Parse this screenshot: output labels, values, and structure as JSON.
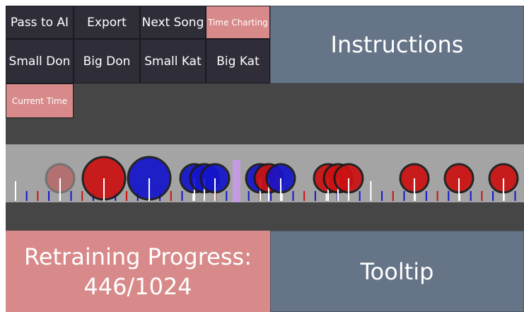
{
  "toolbar": {
    "row1": [
      {
        "label": "Pass to AI",
        "name": "pass-to-ai-button"
      },
      {
        "label": "Export",
        "name": "export-button"
      },
      {
        "label": "Next Song",
        "name": "next-song-button"
      },
      {
        "label": "Time Charting",
        "name": "time-charting-button"
      }
    ],
    "row2": [
      {
        "label": "Small Don",
        "name": "small-don-button"
      },
      {
        "label": "Big Don",
        "name": "big-don-button"
      },
      {
        "label": "Small Kat",
        "name": "small-kat-button"
      },
      {
        "label": "Big Kat",
        "name": "big-kat-button"
      }
    ],
    "current_time": "Current Time"
  },
  "instructions": {
    "label": "Instructions"
  },
  "progress": {
    "line1": "Retraining Progress:",
    "line2": "446/1024"
  },
  "tooltip": {
    "label": "Tooltip"
  },
  "colors": {
    "don": "#cc1111",
    "kat": "#1414cc",
    "accent_pink": "#d88a8a",
    "panel_slate": "#667487",
    "button_dark": "#2f2d38",
    "cursor": "#c49be0"
  },
  "notes": [
    {
      "kind": "don",
      "size": "small",
      "faded": true
    },
    {
      "kind": "don",
      "size": "big",
      "faded": false
    },
    {
      "kind": "kat",
      "size": "big",
      "faded": false
    },
    {
      "kind": "kat",
      "size": "small",
      "faded": false
    },
    {
      "kind": "kat",
      "size": "small",
      "faded": false
    },
    {
      "kind": "kat",
      "size": "small",
      "faded": false
    },
    {
      "kind": "kat",
      "size": "small",
      "faded": false
    },
    {
      "kind": "don",
      "size": "small",
      "faded": false
    },
    {
      "kind": "kat",
      "size": "small",
      "faded": false
    },
    {
      "kind": "don",
      "size": "small",
      "faded": false
    },
    {
      "kind": "don",
      "size": "small",
      "faded": false
    },
    {
      "kind": "don",
      "size": "small",
      "faded": false
    },
    {
      "kind": "don",
      "size": "small",
      "faded": false
    },
    {
      "kind": "don",
      "size": "small",
      "faded": false
    },
    {
      "kind": "don",
      "size": "small",
      "faded": false
    }
  ]
}
